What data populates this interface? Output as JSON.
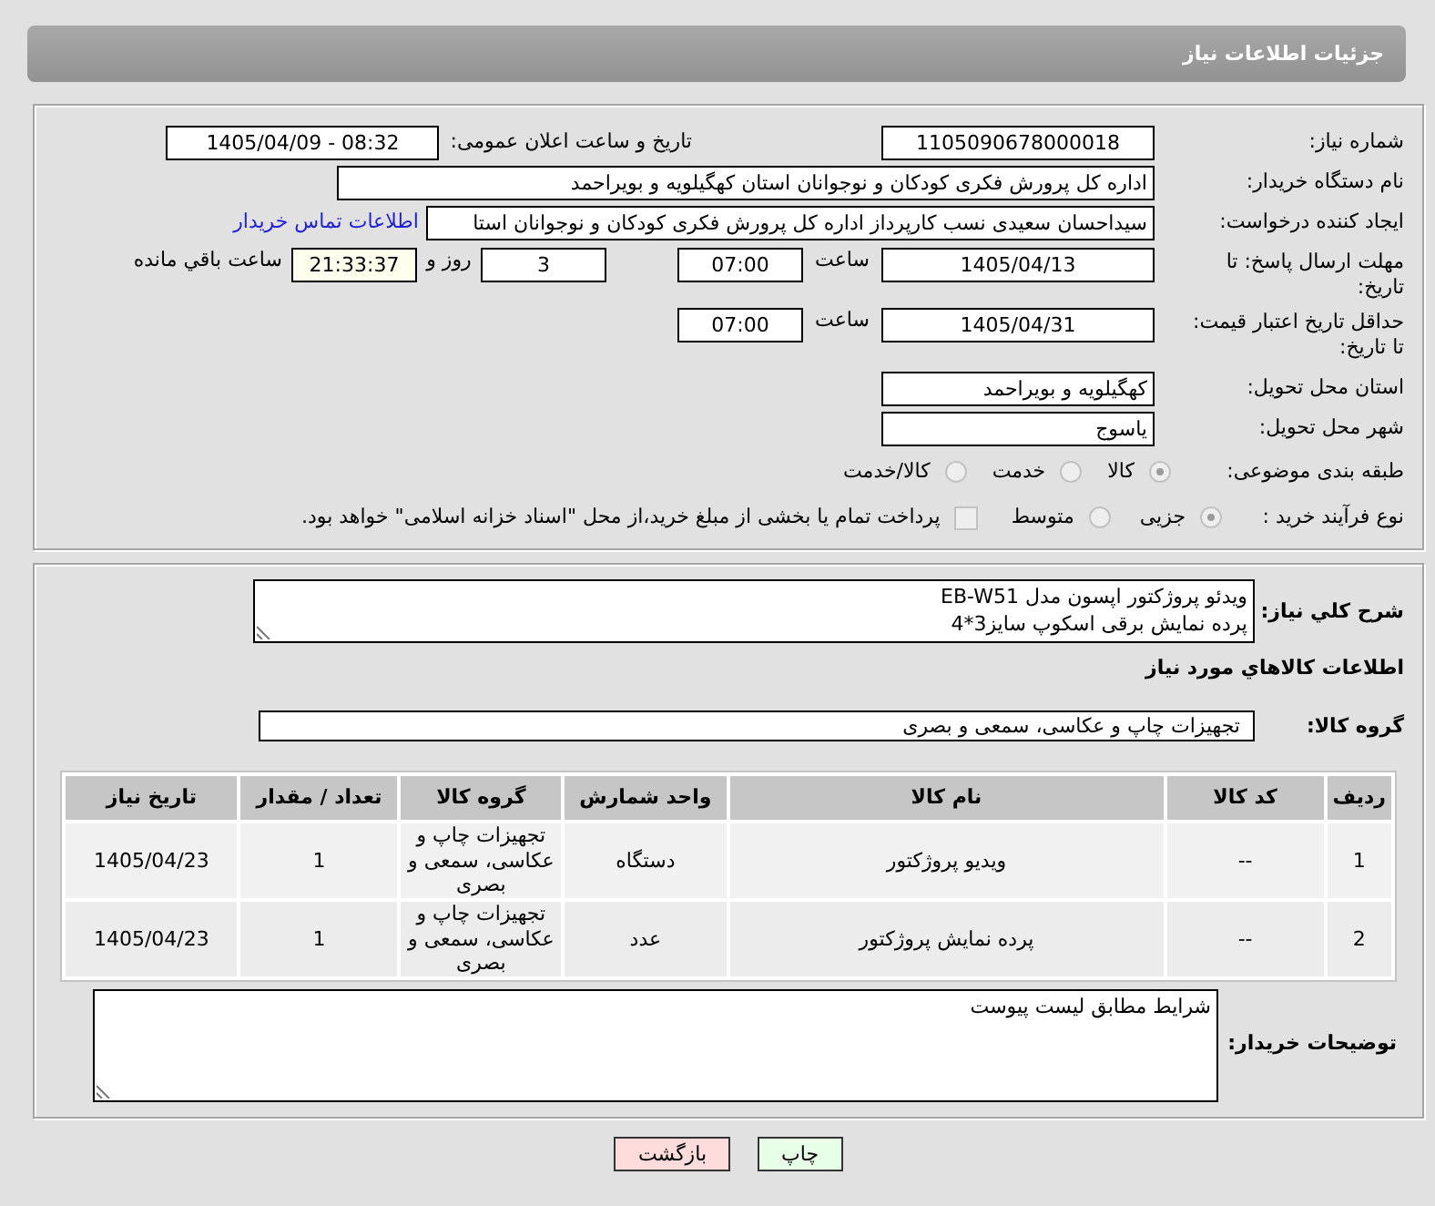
{
  "header": {
    "title": "جزئیات اطلاعات نیاز"
  },
  "details": {
    "need_number": {
      "label": "شماره نیاز:",
      "value": "1105090678000018"
    },
    "announce": {
      "label": "تاریخ و ساعت اعلان عمومی:",
      "value": "1405/04/09 - 08:32"
    },
    "buyer": {
      "label": "نام دستگاه خریدار:",
      "value": "اداره کل پرورش فکری کودکان و نوجوانان استان کهگیلویه و بویراحمد"
    },
    "creator": {
      "label": "ایجاد کننده درخواست:",
      "value": "سیداحسان سعیدی نسب کارپرداز اداره کل پرورش فکری کودکان و نوجوانان استا",
      "link": "اطلاعات تماس خریدار"
    },
    "deadline": {
      "label": "مهلت ارسال پاسخ: تا تاریخ:",
      "date": "1405/04/13",
      "time_label": "ساعت",
      "time": "07:00",
      "days": "3",
      "days_label": "روز و",
      "remaining": "21:33:37",
      "remaining_label": "ساعت باقي مانده"
    },
    "validity": {
      "label": "حداقل تاریخ اعتبار قیمت: تا تاریخ:",
      "date": "1405/04/31",
      "time_label": "ساعت",
      "time": "07:00"
    },
    "province": {
      "label": "استان محل تحویل:",
      "value": "کهگیلویه و بویراحمد"
    },
    "city": {
      "label": "شهر محل تحویل:",
      "value": "یاسوج"
    },
    "category": {
      "label": "طبقه بندی موضوعی:",
      "options": [
        {
          "label": "کالا",
          "selected": true,
          "disabled": true
        },
        {
          "label": "خدمت",
          "selected": false,
          "disabled": true
        },
        {
          "label": "کالا/خدمت",
          "selected": false,
          "disabled": true
        }
      ]
    },
    "process": {
      "label": "نوع فرآیند خرید :",
      "options": [
        {
          "label": "جزیی",
          "selected": true,
          "disabled": true
        },
        {
          "label": "متوسط",
          "selected": false,
          "disabled": true
        }
      ],
      "treasury": {
        "label": "پرداخت تمام یا بخشی از مبلغ خرید،از محل \"اسناد خزانه اسلامی\" خواهد بود.",
        "checked": false
      }
    }
  },
  "description": {
    "label": "شرح کلي نیاز:",
    "lines": [
      "ویدئو پروژکتور اپسون مدل EB-W51",
      "پرده نمایش برقی اسکوپ سایز3*4"
    ]
  },
  "goods": {
    "heading": "اطلاعات کالاهاي مورد نیاز",
    "group_label": "گروه کالا:",
    "group_value": "تجهیزات چاپ و عکاسی، سمعی و بصری",
    "table": {
      "columns": [
        "ردیف",
        "کد کالا",
        "نام کالا",
        "واحد شمارش",
        "گروه کالا",
        "تعداد / مقدار",
        "تاریخ نیاز"
      ],
      "rows": [
        {
          "cells": [
            "1",
            "--",
            "ویدیو پروژکتور",
            "دستگاه",
            "تجهیزات چاپ و عکاسی، سمعی و بصری",
            "1",
            "1405/04/23"
          ]
        },
        {
          "cells": [
            "2",
            "--",
            "پرده نمایش پروژکتور",
            "عدد",
            "تجهیزات چاپ و عکاسی، سمعی و بصری",
            "1",
            "1405/04/23"
          ]
        }
      ]
    }
  },
  "buyer_notes": {
    "label": "توضیحات خریدار:",
    "value": "شرایط مطابق لیست پیوست"
  },
  "buttons": [
    {
      "label": "چاپ",
      "kind": "print"
    },
    {
      "label": "بازگشت",
      "kind": "back"
    }
  ]
}
